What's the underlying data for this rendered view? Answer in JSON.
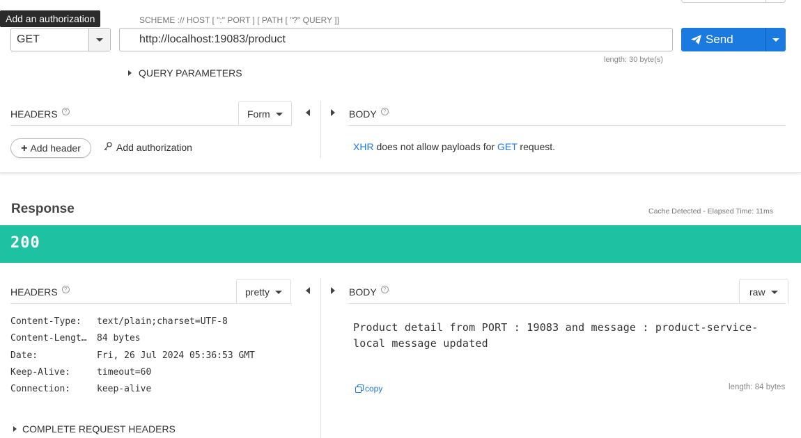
{
  "tooltip": {
    "text": "Add an authorization"
  },
  "request": {
    "method": "GET",
    "scheme_label": "SCHEME :// HOST [ \":\" PORT ] [ PATH [ \"?\" QUERY ]]",
    "url": "http://localhost:19083/product",
    "url_length": "length: 30 byte(s)",
    "send_label": "Send",
    "query_parameters_label": "QUERY PARAMETERS",
    "headers_title": "HEADERS",
    "headers_mode": "Form",
    "add_header_label": "Add header",
    "add_authorization_label": "Add authorization",
    "body_title": "BODY",
    "body_message": {
      "xhr": "XHR",
      "middle": " does not allow payloads for ",
      "method": "GET",
      "end": " request."
    }
  },
  "response": {
    "title": "Response",
    "meta": "Cache Detected - Elapsed Time: 11ms",
    "status_code": "200",
    "headers_title": "HEADERS",
    "headers_mode": "pretty",
    "headers": [
      {
        "key": "Content-Type:",
        "value": "text/plain;charset=UTF-8"
      },
      {
        "key": "Content-Lengt…",
        "value": "84 bytes"
      },
      {
        "key": "Date:",
        "value": "Fri, 26 Jul 2024 05:36:53 GMT"
      },
      {
        "key": "Keep-Alive:",
        "value": "timeout=60"
      },
      {
        "key": "Connection:",
        "value": "keep-alive"
      }
    ],
    "complete_request_headers_label": "COMPLETE REQUEST HEADERS",
    "body_title": "BODY",
    "body_mode": "raw",
    "body_text": "Product detail from PORT : 19083 and message : product-service-local message updated",
    "copy_label": "copy",
    "body_length": "length: 84 bytes"
  },
  "colors": {
    "accent": "#1a7ae0",
    "status_success": "#1ec2a2"
  },
  "icons": [
    "caret-down-icon",
    "send-plane-icon",
    "triangle-right-icon",
    "triangle-left-icon",
    "help-icon",
    "plus-icon",
    "key-icon",
    "copy-icon"
  ]
}
